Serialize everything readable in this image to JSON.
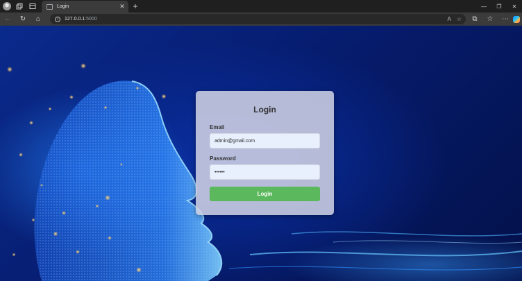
{
  "browser": {
    "tab": {
      "title": "Login"
    },
    "address": {
      "host": "127.0.0.1",
      "port": ":5000"
    },
    "icons": {
      "profile": "avatar-icon",
      "workspaces": "workspaces-icon",
      "tab_actions": "tab-actions-icon",
      "tab_close": "close-icon",
      "new_tab": "plus-icon",
      "back": "back-arrow-icon",
      "refresh": "refresh-icon",
      "home": "home-icon",
      "site_info": "info-icon",
      "read_aloud": "read-aloud-icon",
      "favorite": "star-icon",
      "extensions": "puzzle-icon",
      "favorites_bar": "favorites-icon",
      "more": "more-icon",
      "copilot": "copilot-icon"
    },
    "glyphs": {
      "tab_close": "✕",
      "new_tab": "+",
      "back": "←",
      "refresh": "↻",
      "home": "⌂",
      "info": "i",
      "read_aloud": "A",
      "favorite": "☆",
      "extensions": "⧉",
      "favorites_bar": "☆",
      "more": "⋯",
      "minimize": "—",
      "restore": "❐",
      "close": "✕"
    }
  },
  "login": {
    "title": "Login",
    "email_label": "Email",
    "email_value": "admin@gmail.com",
    "password_label": "Password",
    "password_value": "••••••",
    "button_label": "Login",
    "button_color": "#5cb85c",
    "card_color": "#ced0e2"
  }
}
